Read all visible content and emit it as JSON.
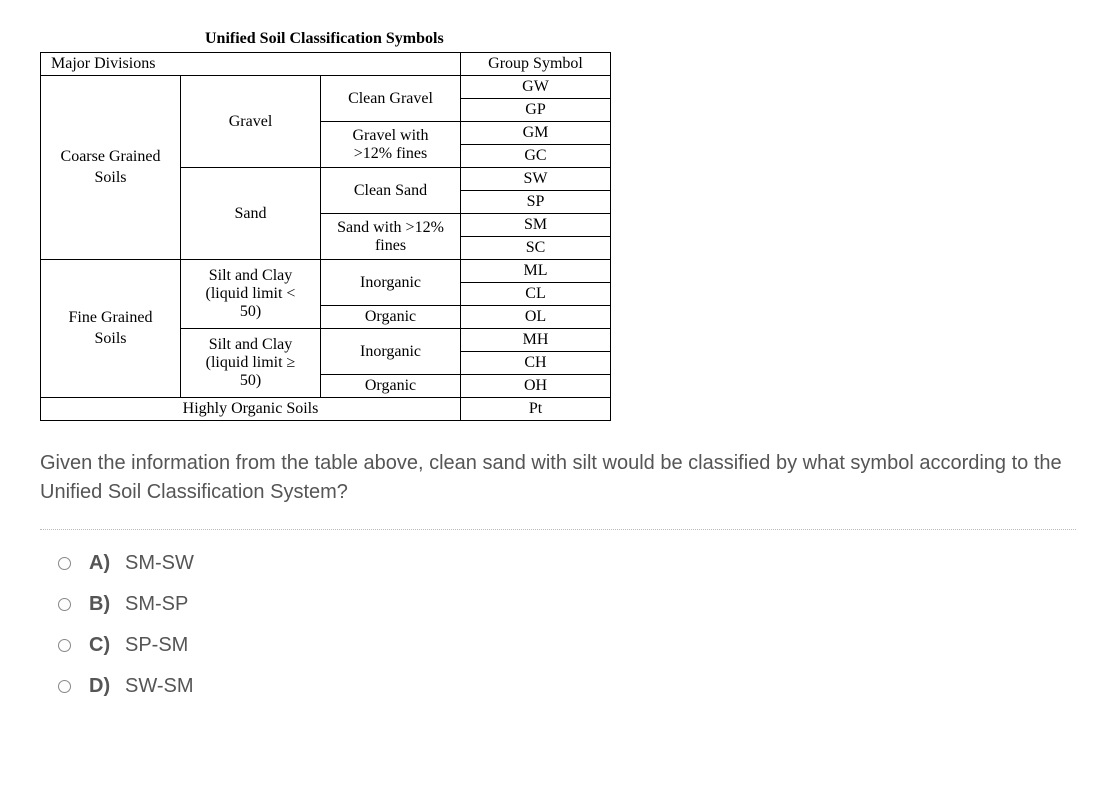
{
  "title": "Unified Soil Classification Symbols",
  "headers": {
    "major": "Major Divisions",
    "group": "Group Symbol"
  },
  "coarse": {
    "label": "Coarse Grained Soils",
    "gravel": {
      "label": "Gravel",
      "clean": {
        "label": "Clean Gravel",
        "sym1": "GW",
        "sym2": "GP"
      },
      "withFines": {
        "label1": "Gravel with",
        "label2": ">12% fines",
        "sym1": "GM",
        "sym2": "GC"
      }
    },
    "sand": {
      "label": "Sand",
      "clean": {
        "label": "Clean Sand",
        "sym1": "SW",
        "sym2": "SP"
      },
      "withFines": {
        "label1": "Sand with >12%",
        "label2": "fines",
        "sym1": "SM",
        "sym2": "SC"
      }
    }
  },
  "fine": {
    "label": "Fine Grained Soils",
    "lowLL": {
      "label1": "Silt and Clay",
      "label2": "(liquid limit <",
      "label3": "50)",
      "inorganic": {
        "label": "Inorganic",
        "sym1": "ML",
        "sym2": "CL"
      },
      "organic": {
        "label": "Organic",
        "sym": "OL"
      }
    },
    "highLL": {
      "label1": "Silt and Clay",
      "label2": "(liquid limit ≥",
      "label3": "50)",
      "inorganic": {
        "label": "Inorganic",
        "sym1": "MH",
        "sym2": "CH"
      },
      "organic": {
        "label": "Organic",
        "sym": "OH"
      }
    }
  },
  "organicSoils": {
    "label": "Highly Organic Soils",
    "sym": "Pt"
  },
  "question": "Given the information from the table above, clean sand with silt would be classified by what symbol according to the Unified Soil Classification System?",
  "options": {
    "A": {
      "letter": "A)",
      "text": "SM-SW"
    },
    "B": {
      "letter": "B)",
      "text": "SM-SP"
    },
    "C": {
      "letter": "C)",
      "text": "SP-SM"
    },
    "D": {
      "letter": "D)",
      "text": "SW-SM"
    }
  }
}
